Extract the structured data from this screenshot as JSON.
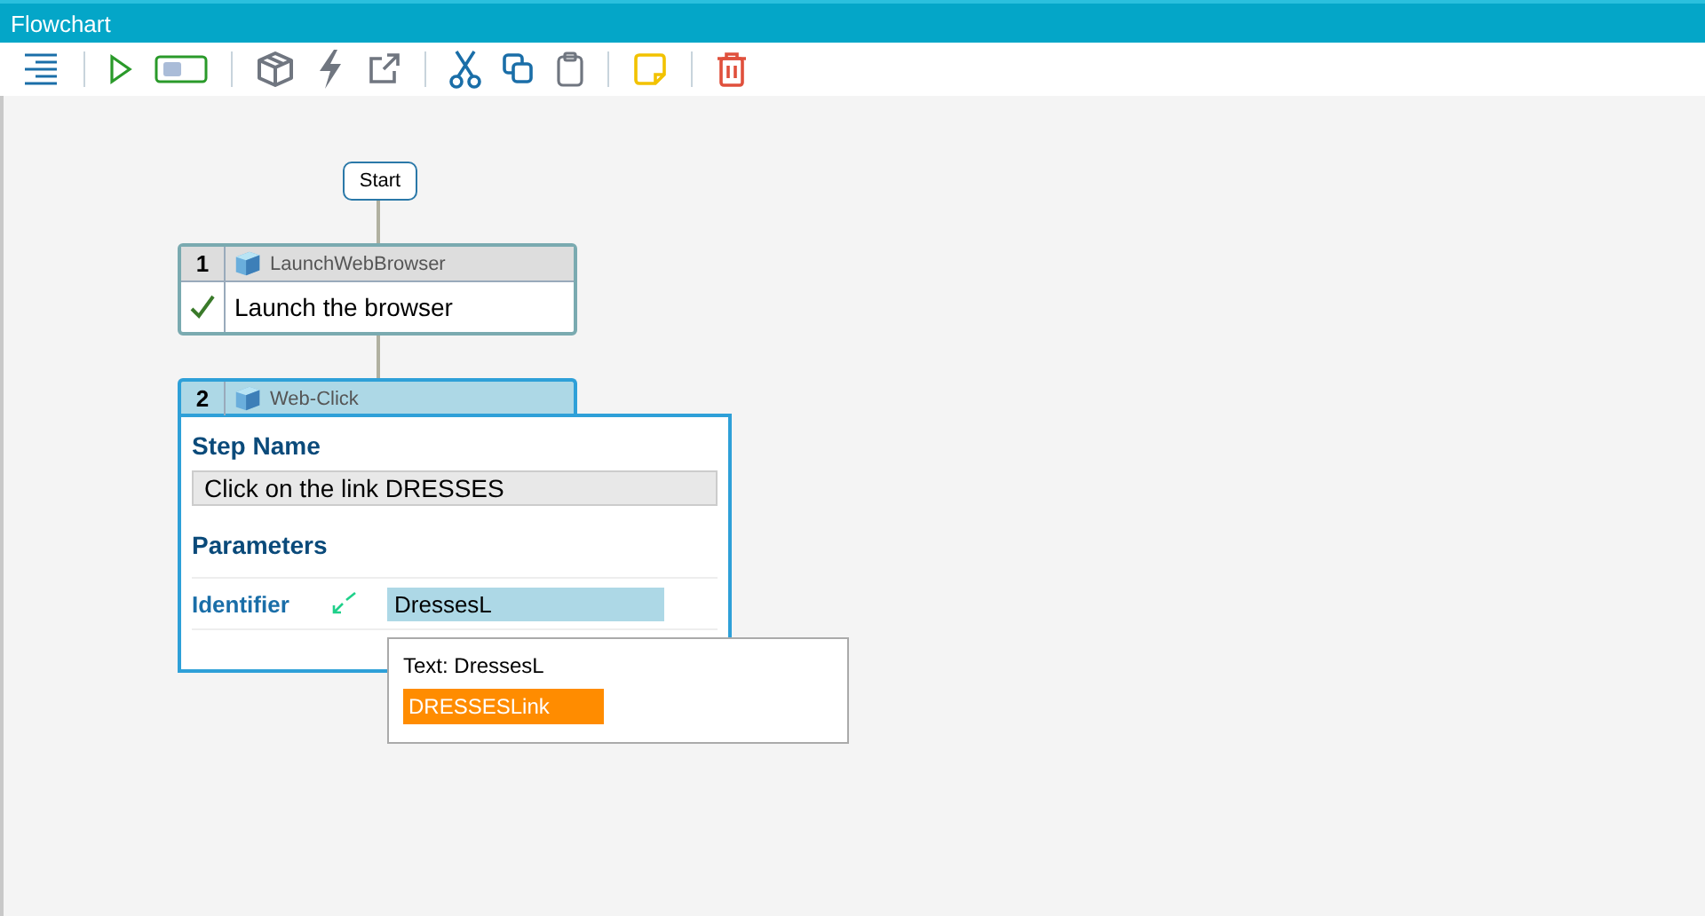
{
  "window": {
    "title": "Flowchart"
  },
  "start": {
    "label": "Start"
  },
  "steps": [
    {
      "number": "1",
      "type": "LaunchWebBrowser",
      "expanded": false,
      "selected": false,
      "done": true,
      "name": "Launch the browser"
    },
    {
      "number": "2",
      "type": "Web-Click",
      "expanded": true,
      "selected": true,
      "step_name_label": "Step Name",
      "step_name": "Click on the link DRESSES",
      "parameters_label": "Parameters",
      "parameters": [
        {
          "label": "Identifier",
          "value": "DressesL"
        }
      ]
    }
  ],
  "autocomplete": {
    "hint": "Text: DressesL",
    "options": [
      {
        "label": "DRESSESLink",
        "selected": true
      }
    ]
  }
}
